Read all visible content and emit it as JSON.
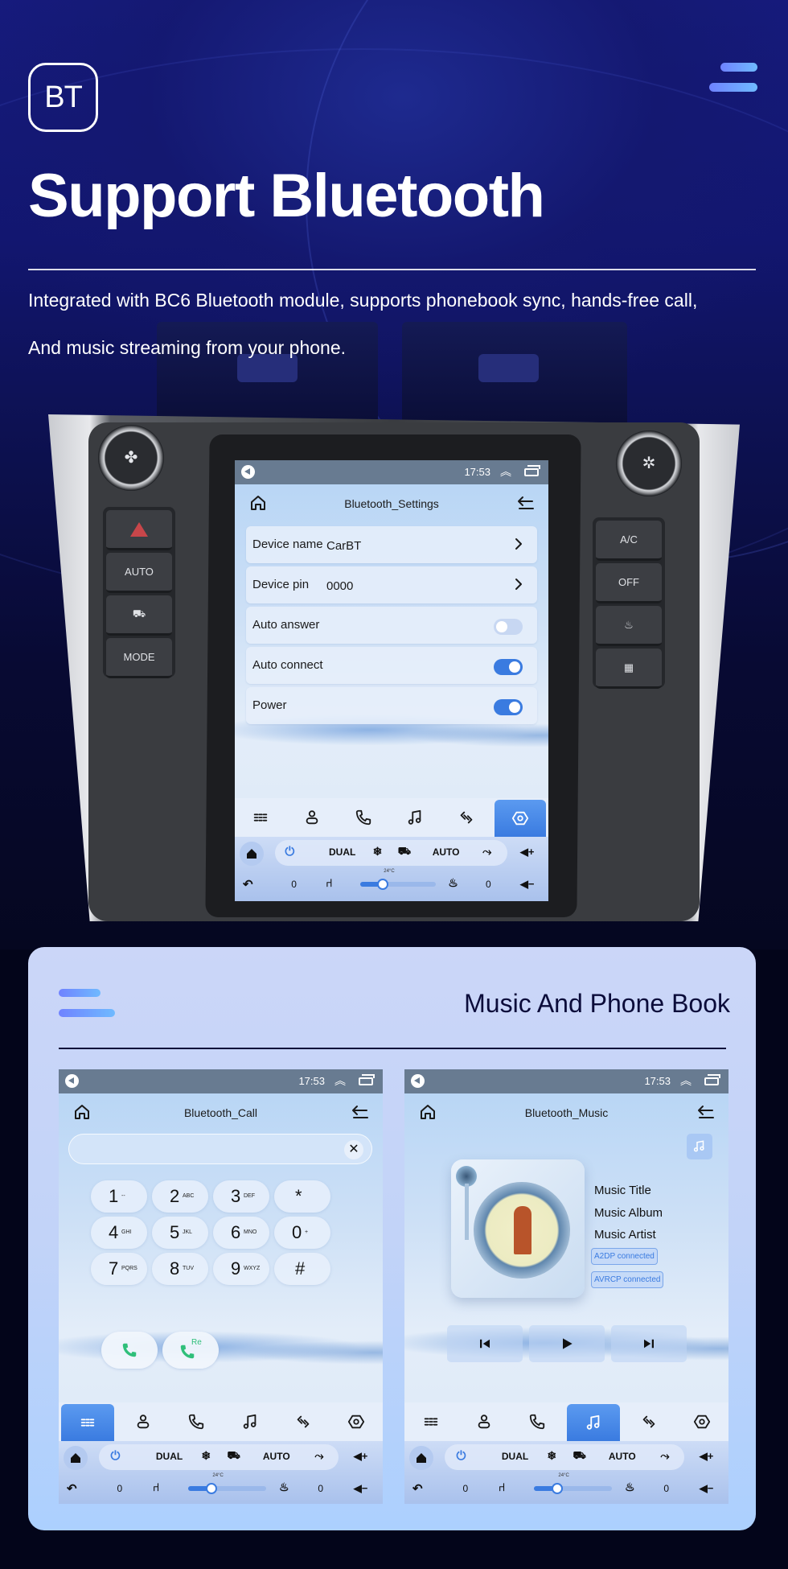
{
  "hero": {
    "logo_text": "BT",
    "title": "Support Bluetooth",
    "description_line1": "Integrated with BC6 Bluetooth module, supports phonebook sync, hands-free call,",
    "description_line2": "And music streaming from your phone."
  },
  "head_unit": {
    "left_buttons": [
      "hazard",
      "AUTO",
      "recirculation",
      "MODE"
    ],
    "left_button_labels": {
      "auto": "AUTO",
      "mode": "MODE"
    },
    "right_button_labels": {
      "ac": "A/C",
      "off": "OFF"
    },
    "left_knob_icon": "fan-icon",
    "right_knob_icon": "temperature-icon"
  },
  "status_bar": {
    "time": "17:53",
    "up_glyph": "︽"
  },
  "settings_screen": {
    "title": "Bluetooth_Settings",
    "rows": [
      {
        "label": "Device name",
        "value": "CarBT",
        "type": "link"
      },
      {
        "label": "Device pin",
        "value": "0000",
        "type": "link"
      },
      {
        "label": "Auto answer",
        "type": "toggle",
        "on": false
      },
      {
        "label": "Auto connect",
        "type": "toggle",
        "on": true
      },
      {
        "label": "Power",
        "type": "toggle",
        "on": true
      }
    ],
    "active_tab": "settings"
  },
  "app_tabs": [
    "dialpad",
    "contacts",
    "call-log",
    "music",
    "link",
    "settings"
  ],
  "climate": {
    "dual": "DUAL",
    "auto": "AUTO",
    "temperature": "24°C",
    "left_seat_level": "0",
    "right_seat_level": "0",
    "fan_level": 0.3
  },
  "panel": {
    "title": "Music And Phone Book"
  },
  "call_screen": {
    "title": "Bluetooth_Call",
    "input_value": "",
    "keys": [
      {
        "digit": "1",
        "sub": "--"
      },
      {
        "digit": "2",
        "sub": "ABC"
      },
      {
        "digit": "3",
        "sub": "DEF"
      },
      {
        "digit": "*",
        "sub": ""
      },
      {
        "digit": "4",
        "sub": "GHI"
      },
      {
        "digit": "5",
        "sub": "JKL"
      },
      {
        "digit": "6",
        "sub": "MNO"
      },
      {
        "digit": "0",
        "sub": "+"
      },
      {
        "digit": "7",
        "sub": "PQRS"
      },
      {
        "digit": "8",
        "sub": "TUV"
      },
      {
        "digit": "9",
        "sub": "WXYZ"
      },
      {
        "digit": "#",
        "sub": ""
      }
    ],
    "redial_label": "Re",
    "active_tab": "dialpad"
  },
  "music_screen": {
    "title": "Bluetooth_Music",
    "track_title": "Music Title",
    "album": "Music Album",
    "artist": "Music Artist",
    "badges": [
      "A2DP  connected",
      "AVRCP connected"
    ],
    "active_tab": "music"
  },
  "colors": {
    "accent_blue": "#3a7be0",
    "call_green": "#2fbf7a",
    "hero_bg": "#121670",
    "panel_bg": "#c2d3f8",
    "heading_dark": "#0b0c3a"
  }
}
